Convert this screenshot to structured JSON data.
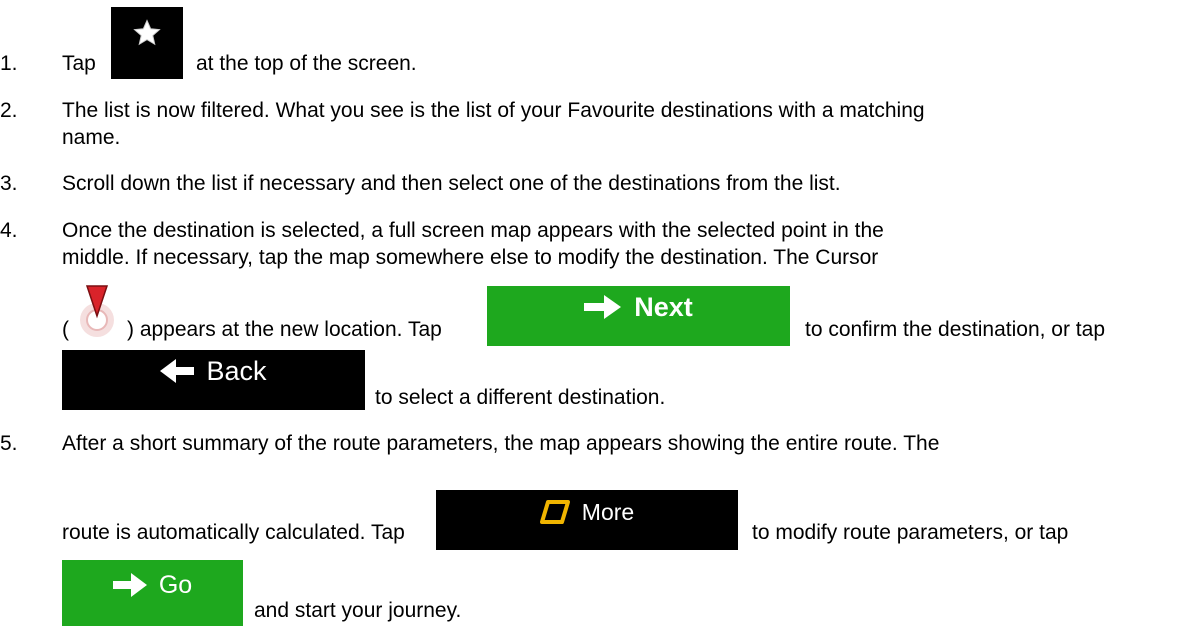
{
  "steps": [
    {
      "number": "1.",
      "lines": [
        "Tap",
        "at the top of the screen."
      ]
    },
    {
      "number": "2.",
      "lines": [
        "The list is now filtered. What you see is the list of your Favourite destinations with a matching",
        "name."
      ]
    },
    {
      "number": "3.",
      "lines": [
        "Scroll down the list if necessary and then select one of the destinations from the list."
      ]
    },
    {
      "number": "4.",
      "lines": [
        "Once the destination is selected, a full screen map appears with the selected point in the",
        "middle. If necessary, tap the map somewhere else to modify the destination. The Cursor",
        "(",
        ") appears at the new location. Tap",
        "to confirm the destination, or tap",
        "to select a different destination."
      ]
    },
    {
      "number": "5.",
      "lines": [
        "After a short summary of the route parameters, the map appears showing the entire route. The",
        "route is automatically calculated. Tap",
        "to modify route parameters, or tap",
        "and start your journey."
      ]
    }
  ],
  "buttons": {
    "favourites": {
      "icon": "star-icon",
      "color": "#000000"
    },
    "next": {
      "label": "Next",
      "icon": "arrow-right-icon",
      "color": "#1ea81e"
    },
    "back": {
      "label": "Back",
      "icon": "arrow-left-icon",
      "color": "#000000"
    },
    "more": {
      "label": "More",
      "icon": "more-shape-icon",
      "color": "#000000",
      "accent": "#f0b400"
    },
    "go": {
      "label": "Go",
      "icon": "arrow-right-icon",
      "color": "#1ea81e"
    }
  },
  "cursor": {
    "icon": "cursor-pin-icon",
    "color": "#d9232a"
  }
}
